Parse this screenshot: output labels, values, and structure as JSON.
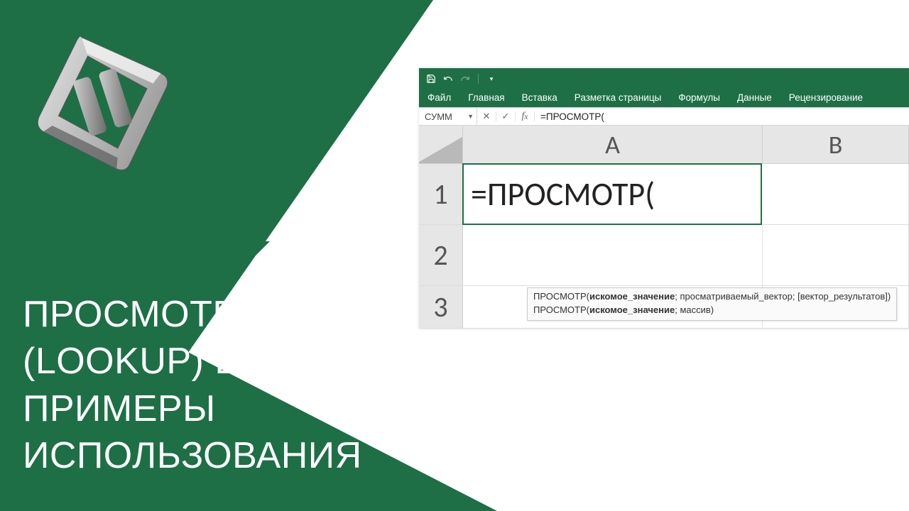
{
  "brand_color": "#1e6f46",
  "headline": {
    "line1": "ПРОСМОТР",
    "line2": "(LOOKUP) В EXCEL,",
    "line3": "ПРИМЕРЫ",
    "line4": "ИСПОЛЬЗОВАНИЯ"
  },
  "excel": {
    "ribbon_tabs": [
      "Файл",
      "Главная",
      "Вставка",
      "Разметка страницы",
      "Формулы",
      "Данные",
      "Рецензирование"
    ],
    "name_box": "СУММ",
    "formula": "=ПРОСМОТР(",
    "columns": [
      "A",
      "B"
    ],
    "rows": [
      "1",
      "2",
      "3"
    ],
    "active_cell_value": "=ПРОСМОТР(",
    "tooltip": {
      "line1_prefix": "ПРОСМОТР(",
      "line1_bold": "искомое_значение",
      "line1_suffix": "; просматриваемый_вектор; [вектор_результатов])",
      "line2_prefix": "ПРОСМОТР(",
      "line2_bold": "искомое_значение",
      "line2_suffix": "; массив)"
    }
  }
}
